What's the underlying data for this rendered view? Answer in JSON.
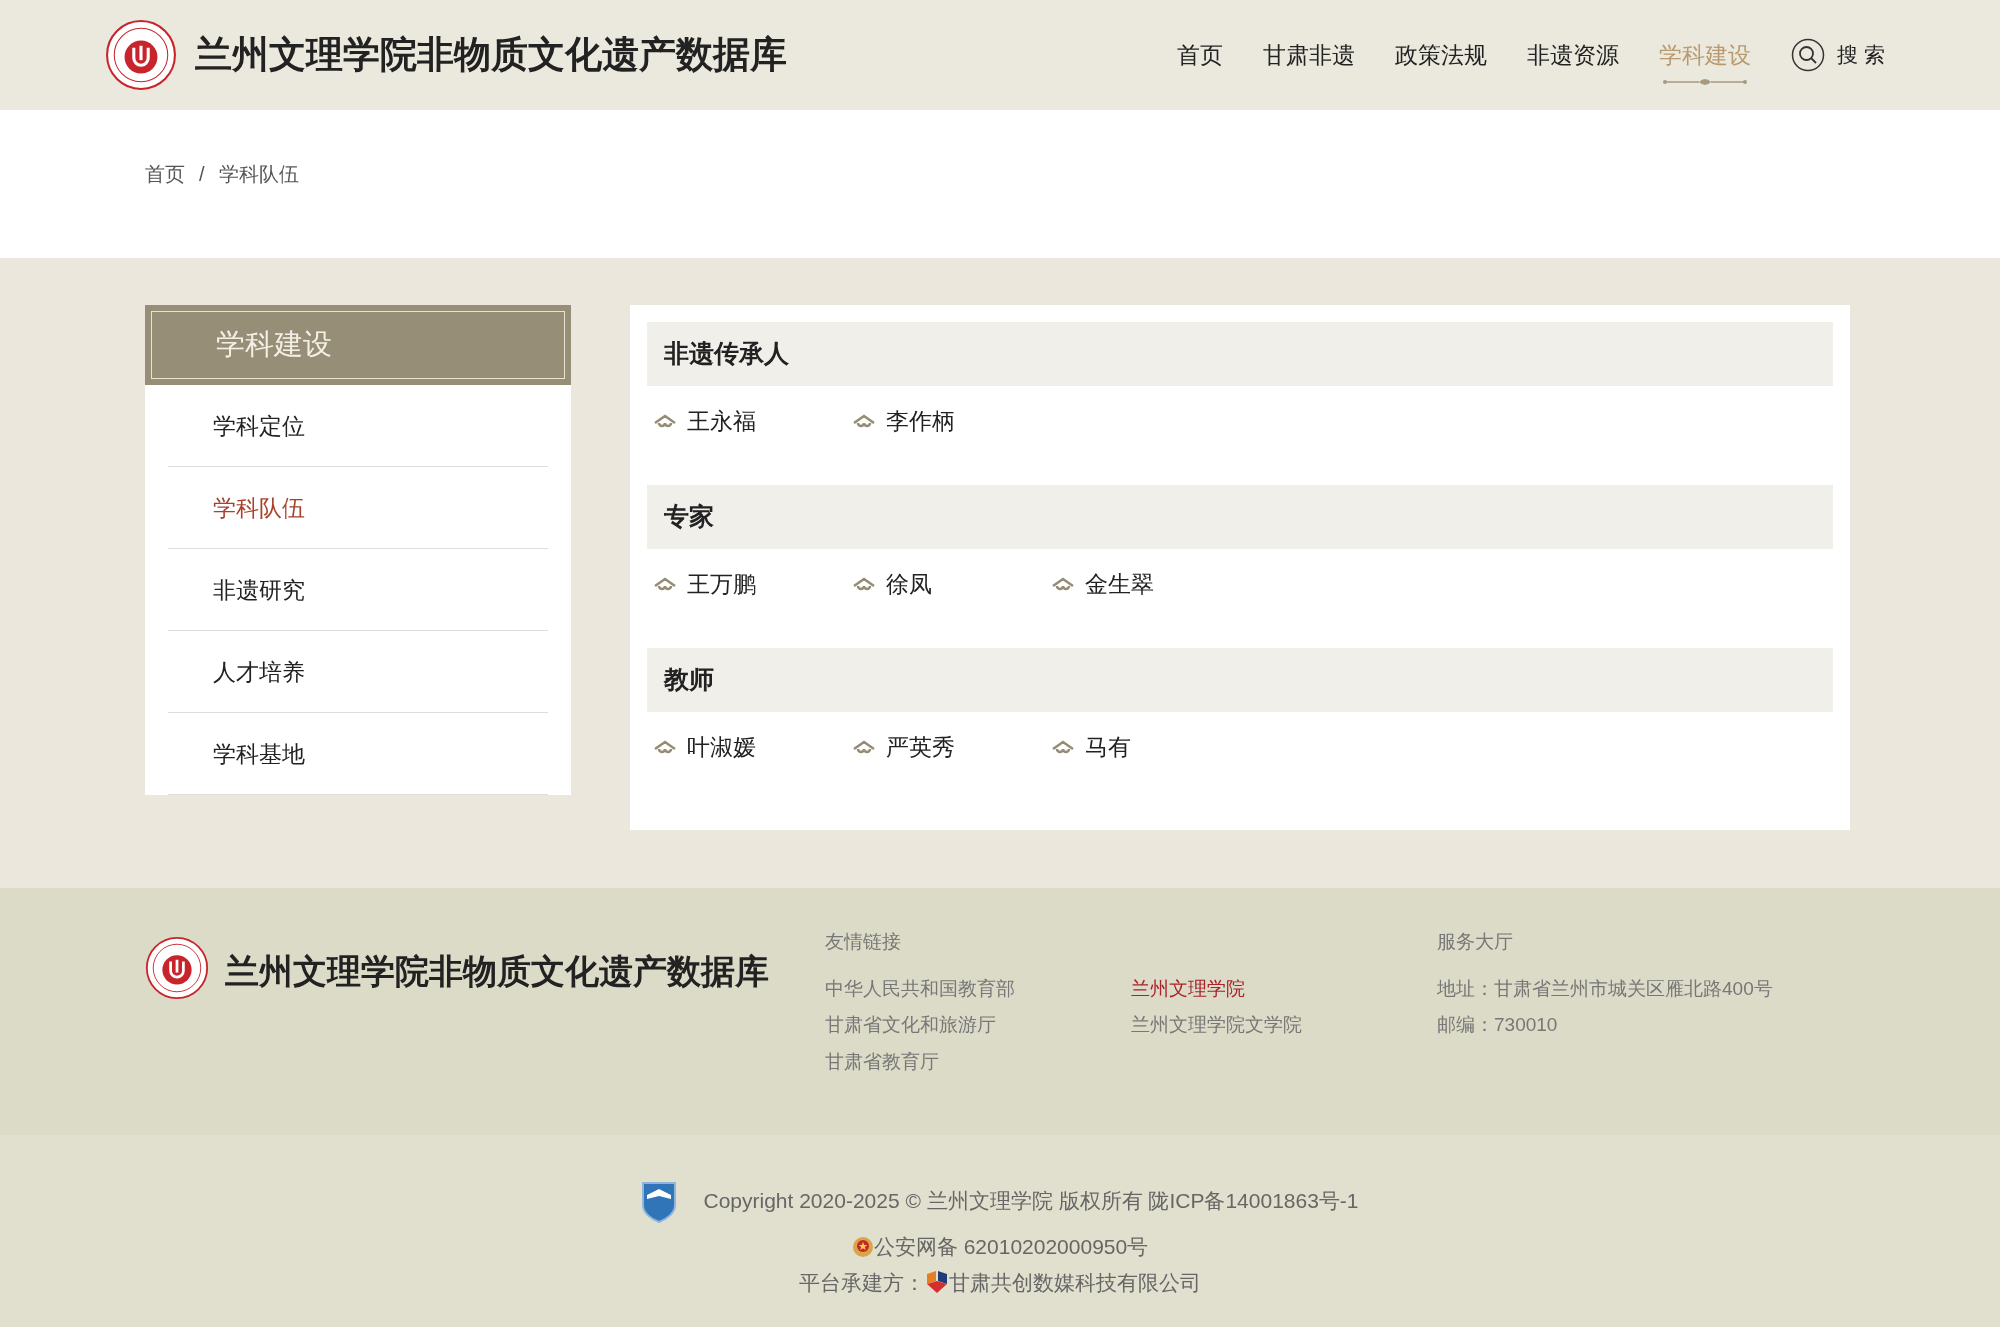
{
  "header": {
    "site_title": "兰州文理学院非物质文化遗产数据库",
    "nav": [
      {
        "label": "首页",
        "selected": false
      },
      {
        "label": "甘肃非遗",
        "selected": false
      },
      {
        "label": "政策法规",
        "selected": false
      },
      {
        "label": "非遗资源",
        "selected": false
      },
      {
        "label": "学科建设",
        "selected": true
      }
    ],
    "search_label": "搜 索"
  },
  "breadcrumb": {
    "items": [
      "首页",
      "学科队伍"
    ],
    "separator": "/"
  },
  "sidebar": {
    "title": "学科建设",
    "items": [
      {
        "label": "学科定位",
        "selected": false
      },
      {
        "label": "学科队伍",
        "selected": true
      },
      {
        "label": "非遗研究",
        "selected": false
      },
      {
        "label": "人才培养",
        "selected": false
      },
      {
        "label": "学科基地",
        "selected": false
      }
    ]
  },
  "sections": [
    {
      "title": "非遗传承人",
      "people": [
        "王永福",
        "李作柄"
      ]
    },
    {
      "title": "专家",
      "people": [
        "王万鹏",
        "徐凤",
        "金生翠"
      ]
    },
    {
      "title": "教师",
      "people": [
        "叶淑媛",
        "严英秀",
        "马有"
      ]
    }
  ],
  "footer": {
    "site_title": "兰州文理学院非物质文化遗产数据库",
    "links_title": "友情链接",
    "links": [
      {
        "label": "中华人民共和国教育部",
        "highlighted": false
      },
      {
        "label": "兰州文理学院",
        "highlighted": true
      },
      {
        "label": "甘肃省文化和旅游厅",
        "highlighted": false
      },
      {
        "label": "兰州文理学院文学院",
        "highlighted": false
      },
      {
        "label": "甘肃省教育厅",
        "highlighted": false
      }
    ],
    "service_title": "服务大厅",
    "service_lines": [
      "地址：甘肃省兰州市城关区雁北路400号",
      "邮编：730010"
    ],
    "copyright": "Copyright 2020-2025 © 兰州文理学院 版权所有 陇ICP备14001863号-1",
    "police_record": "公安网备 62010202000950号",
    "builder_label": "平台承建方：",
    "builder_name": "甘肃共创数媒科技有限公司"
  }
}
